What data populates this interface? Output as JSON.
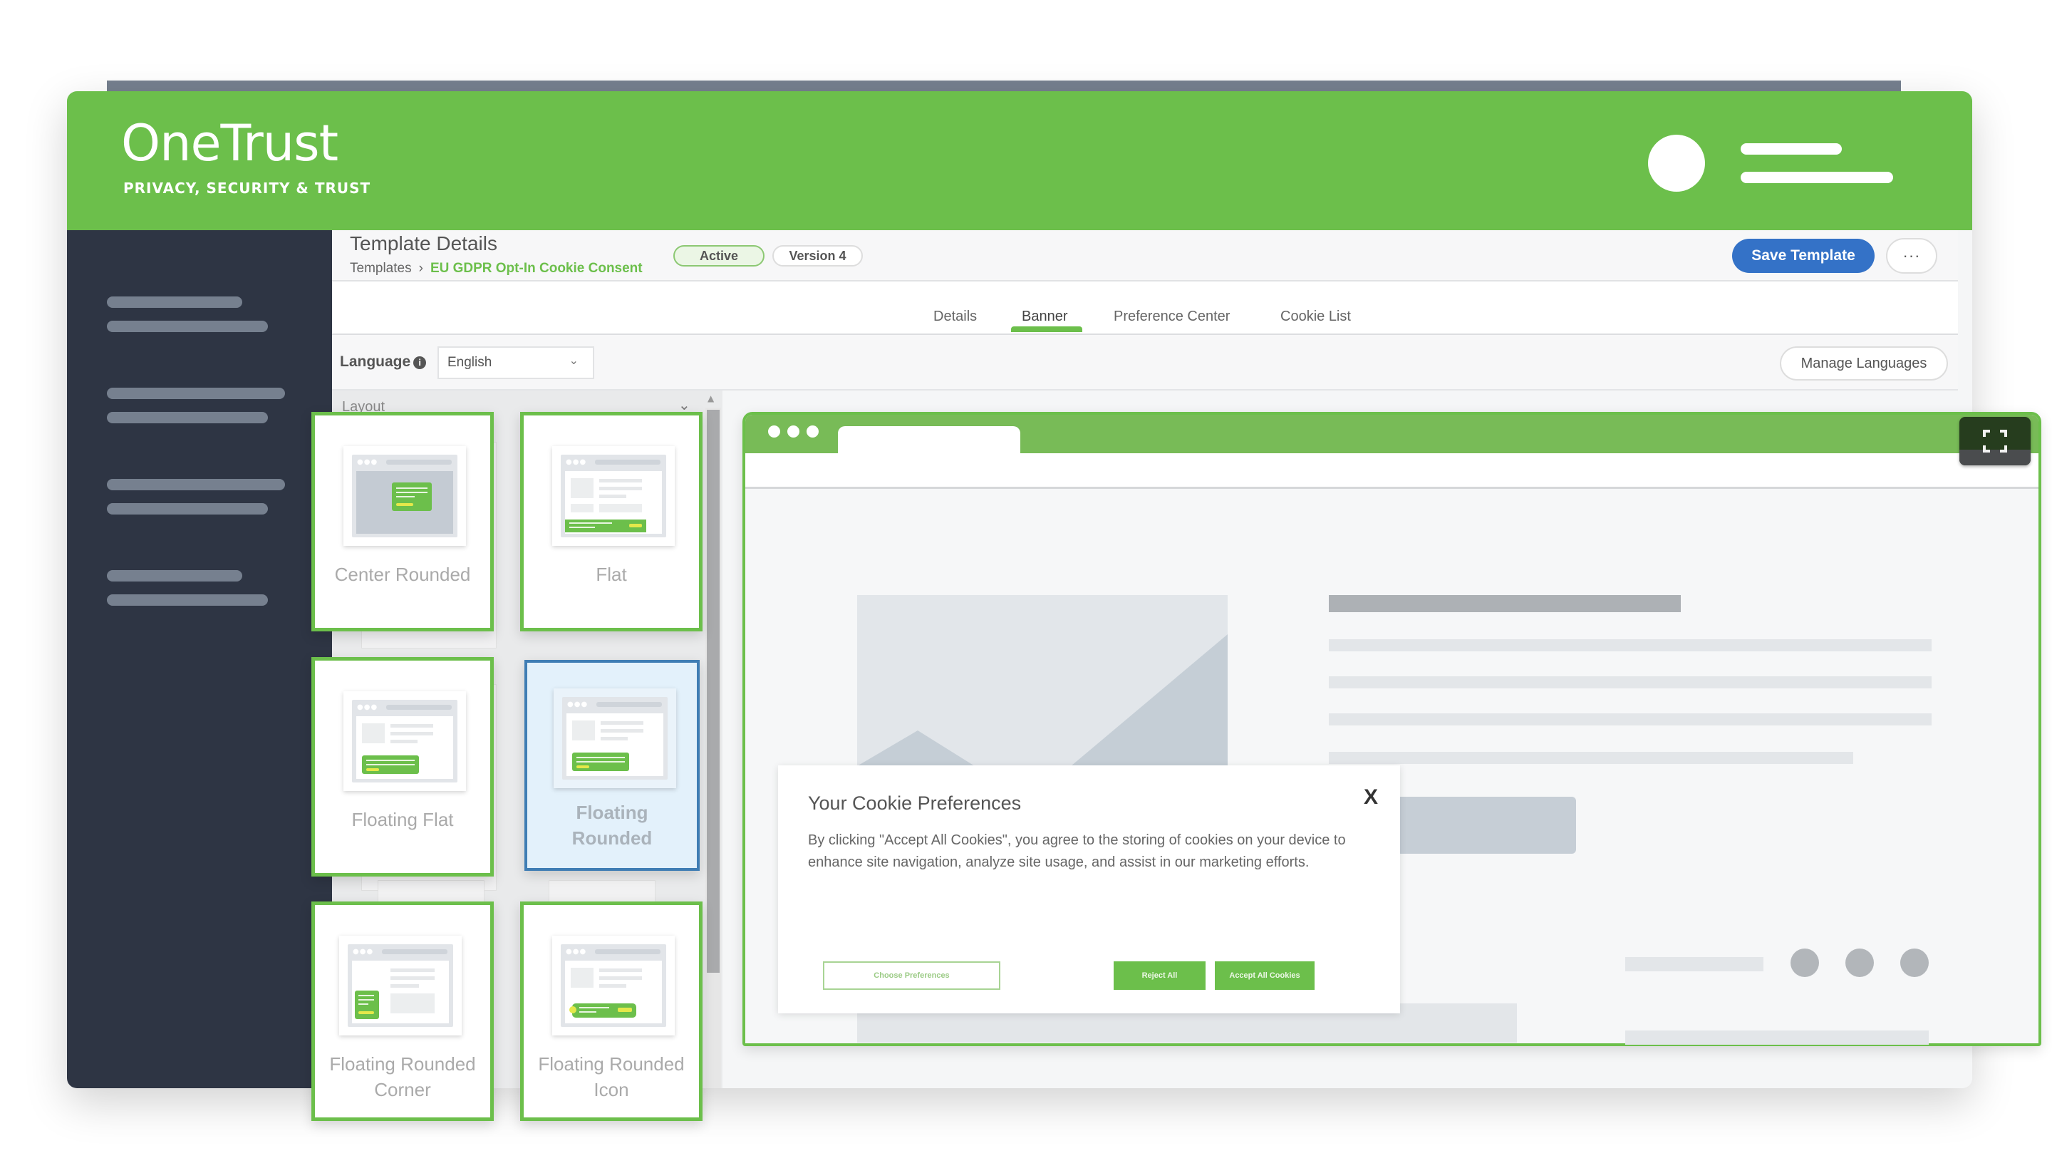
{
  "app": {
    "brand": "OneTrust",
    "tagline": "PRIVACY, SECURITY & TRUST",
    "brand_color": "#6cbf4b",
    "sidebar_color": "#2e3544"
  },
  "header": {
    "title": "Template Details",
    "breadcrumb": {
      "root": "Templates",
      "separator": "›",
      "current": "EU GDPR Opt-In Cookie Consent"
    },
    "status_badge": "Active",
    "version_badge": "Version 4",
    "save_label": "Save Template",
    "more_label": "···",
    "save_color": "#3472c7"
  },
  "tabs": [
    {
      "label": "Details",
      "active": false
    },
    {
      "label": "Banner",
      "active": true
    },
    {
      "label": "Preference Center",
      "active": false
    },
    {
      "label": "Cookie List",
      "active": false
    }
  ],
  "language": {
    "label": "Language",
    "info_icon": "i",
    "selected": "English",
    "manage_label": "Manage Languages"
  },
  "layout_panel": {
    "heading": "Layout",
    "options": [
      {
        "label": "Center Rounded",
        "selected": false
      },
      {
        "label": "Flat",
        "selected": false
      },
      {
        "label": "Floating Flat",
        "selected": false
      },
      {
        "label": "Floating Rounded",
        "selected": true
      },
      {
        "label": "Floating Rounded Corner",
        "selected": false
      },
      {
        "label": "Floating Rounded Icon",
        "selected": false
      }
    ]
  },
  "preview": {
    "fullscreen_icon": "expand-icon",
    "cookie_banner": {
      "title": "Your Cookie Preferences",
      "close": "X",
      "body": "By clicking \"Accept All Cookies\", you agree to the storing of cookies on your device to enhance site navigation, analyze site usage, and assist in our marketing efforts.",
      "choose_label": "Choose Preferences",
      "reject_label": "Reject All",
      "accept_label": "Accept All Cookies"
    }
  }
}
